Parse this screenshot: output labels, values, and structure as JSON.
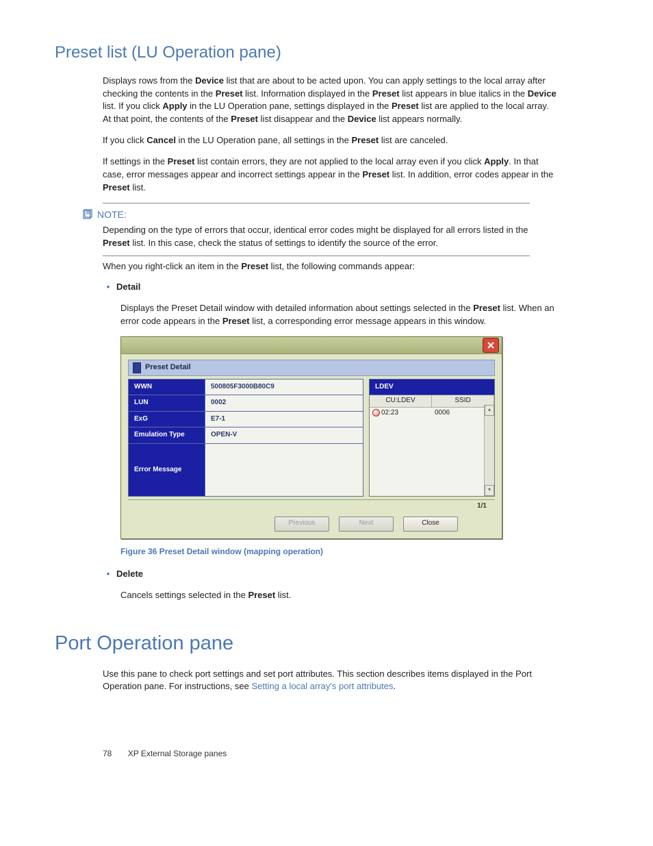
{
  "section1": {
    "heading": "Preset list (LU Operation pane)",
    "p1_parts": [
      "Displays rows from the ",
      "Device",
      " list that are about to be acted upon. You can apply settings to the local array after checking the contents in the ",
      "Preset",
      " list. Information displayed in the ",
      "Preset",
      " list appears in blue italics in the ",
      "Device",
      " list. If you click ",
      "Apply",
      " in the LU Operation pane, settings displayed in the ",
      "Preset",
      " list are applied to the local array. At that point, the contents of the ",
      "Preset",
      " list disappear and the ",
      "Device",
      " list appears normally."
    ],
    "p2_parts": [
      "If you click ",
      "Cancel",
      " in the LU Operation pane, all settings in the ",
      "Preset",
      " list are canceled."
    ],
    "p3_parts": [
      "If settings in the ",
      "Preset",
      " list contain errors, they are not applied to the local array even if you click ",
      "Apply",
      ". In that case, error messages appear and incorrect settings appear in the ",
      "Preset",
      " list. In addition, error codes appear in the ",
      "Preset",
      " list."
    ],
    "note_label": "NOTE:",
    "note_body_parts": [
      "Depending on the type of errors that occur, identical error codes might be displayed for all errors listed in the ",
      "Preset",
      " list. In this case, check the status of settings to identify the source of the error."
    ],
    "p4_parts": [
      "When you right-click an item in the ",
      "Preset",
      " list, the following commands appear:"
    ],
    "detail_label": "Detail",
    "detail_body_parts": [
      "Displays the Preset Detail window with detailed information about settings selected in the ",
      "Preset",
      " list. When an error code appears in the ",
      "Preset",
      " list, a corresponding error message appears in this window."
    ],
    "delete_label": "Delete",
    "delete_body_parts": [
      "Cancels settings selected in the ",
      "Preset",
      " list."
    ]
  },
  "figure": {
    "panel_title": "Preset Detail",
    "rows": {
      "wwn_k": "WWN",
      "wwn_v": "500805F3000B80C9",
      "lun_k": "LUN",
      "lun_v": "0002",
      "exg_k": "ExG",
      "exg_v": "E7-1",
      "emu_k": "Emulation Type",
      "emu_v": "OPEN-V",
      "err_k": "Error Message",
      "err_v": ""
    },
    "ldev_head": "LDEV",
    "ldev_cols": {
      "c1": "CU:LDEV",
      "c2": "SSID"
    },
    "ldev_row": {
      "c1": "02:23",
      "c2": "0006"
    },
    "pager": "1/1",
    "btn_prev": "Previous",
    "btn_next": "Next",
    "btn_close": "Close",
    "caption": "Figure 36 Preset Detail window (mapping operation)"
  },
  "section2": {
    "heading": "Port Operation pane",
    "p1": "Use this pane to check port settings and set port attributes. This section describes items displayed in the Port Operation pane. For instructions, see ",
    "link": "Setting a local array's port attributes",
    "p1_tail": "."
  },
  "footer": {
    "page": "78",
    "title": "XP External Storage panes"
  }
}
